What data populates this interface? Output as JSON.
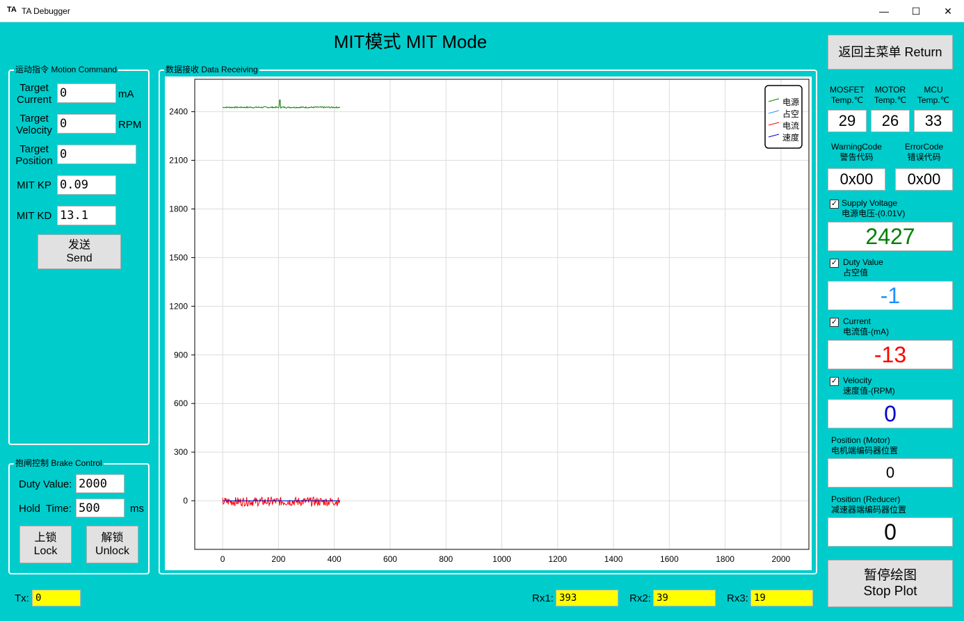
{
  "window": {
    "icon": "TA",
    "title": "TA Debugger",
    "minimize": "—",
    "maximize": "☐",
    "close": "✕"
  },
  "page_title": "MIT模式 MIT Mode",
  "motion": {
    "group_label": "运动指令 Motion Command",
    "target_current_label": "Target\nCurrent",
    "target_current": "0",
    "current_unit": "mA",
    "target_velocity_label": "Target\nVelocity",
    "target_velocity": "0",
    "velocity_unit": "RPM",
    "target_position_label": "Target\nPosition",
    "target_position": "0",
    "kp_label": "MIT KP",
    "kp": "0.09",
    "kd_label": "MIT KD",
    "kd": "13.1",
    "send_zh": "发送",
    "send_en": "Send"
  },
  "brake": {
    "group_label": "抱闸控制 Brake Control",
    "duty_label": "Duty Value:",
    "duty": "2000",
    "hold_label": "Hold  Time:",
    "hold": "500",
    "hold_unit": "ms",
    "lock_zh": "上锁",
    "lock_en": "Lock",
    "unlock_zh": "解锁",
    "unlock_en": "Unlock"
  },
  "data_group_label": "数据接收 Data Receiving",
  "chart_data": {
    "type": "line",
    "xlim": [
      -100,
      2100
    ],
    "ylim": [
      -300,
      2600
    ],
    "xticks": [
      0,
      200,
      400,
      600,
      800,
      1000,
      1200,
      1400,
      1600,
      1800,
      2000
    ],
    "yticks": [
      0,
      300,
      600,
      900,
      1200,
      1500,
      1800,
      2100,
      2400
    ],
    "grid": true,
    "legend_placement": "top-right",
    "series": [
      {
        "name": "电源",
        "color": "#008000",
        "x_range": [
          0,
          420
        ],
        "base": 2427,
        "noise": 4,
        "spike": {
          "x": 205,
          "y": 2472
        }
      },
      {
        "name": "占空",
        "color": "#1E90FF",
        "x_range": [
          0,
          420
        ],
        "base": -1,
        "noise": 0
      },
      {
        "name": "电流",
        "color": "#FF0000",
        "x_range": [
          0,
          420
        ],
        "base": -5,
        "noise": 28
      },
      {
        "name": "速度",
        "color": "#0000CD",
        "x_range": [
          0,
          420
        ],
        "base": 0,
        "noise": 0
      }
    ]
  },
  "temps": {
    "mosfet_label": "MOSFET\nTemp.℃",
    "motor_label": "MOTOR\nTemp.℃",
    "mcu_label": "MCU\nTemp.℃",
    "mosfet": "29",
    "motor": "26",
    "mcu": "33"
  },
  "codes": {
    "warning_label": "WarningCode\n警告代码",
    "error_label": "ErrorCode\n错误代码",
    "warning": "0x00",
    "error": "0x00"
  },
  "readouts": {
    "return_button": "返回主菜单 Return",
    "supply_label": "Supply Voltage\n电源电压-(0.01V)",
    "supply": "2427",
    "supply_color": "#008000",
    "duty_label": "Duty Value\n占空值",
    "duty": "-1",
    "duty_color": "#1E90FF",
    "current_label": "Current\n电流值-(mA)",
    "current": "-13",
    "current_color": "#FF0000",
    "velocity_label": "Velocity\n速度值-(RPM)",
    "velocity": "0",
    "velocity_color": "#0000CD",
    "pos_motor_label": "Position (Motor)\n电机端编码器位置",
    "pos_motor": "0",
    "pos_reducer_label": "Position (Reducer)\n减速器端编码器位置",
    "pos_reducer": "0",
    "check_mark": "✓",
    "stop_zh": "暂停绘图",
    "stop_en": "Stop Plot"
  },
  "status": {
    "tx_label": "Tx:",
    "tx": "0",
    "rx1_label": "Rx1:",
    "rx1": "393",
    "rx2_label": "Rx2:",
    "rx2": "39",
    "rx3_label": "Rx3:",
    "rx3": "19"
  }
}
